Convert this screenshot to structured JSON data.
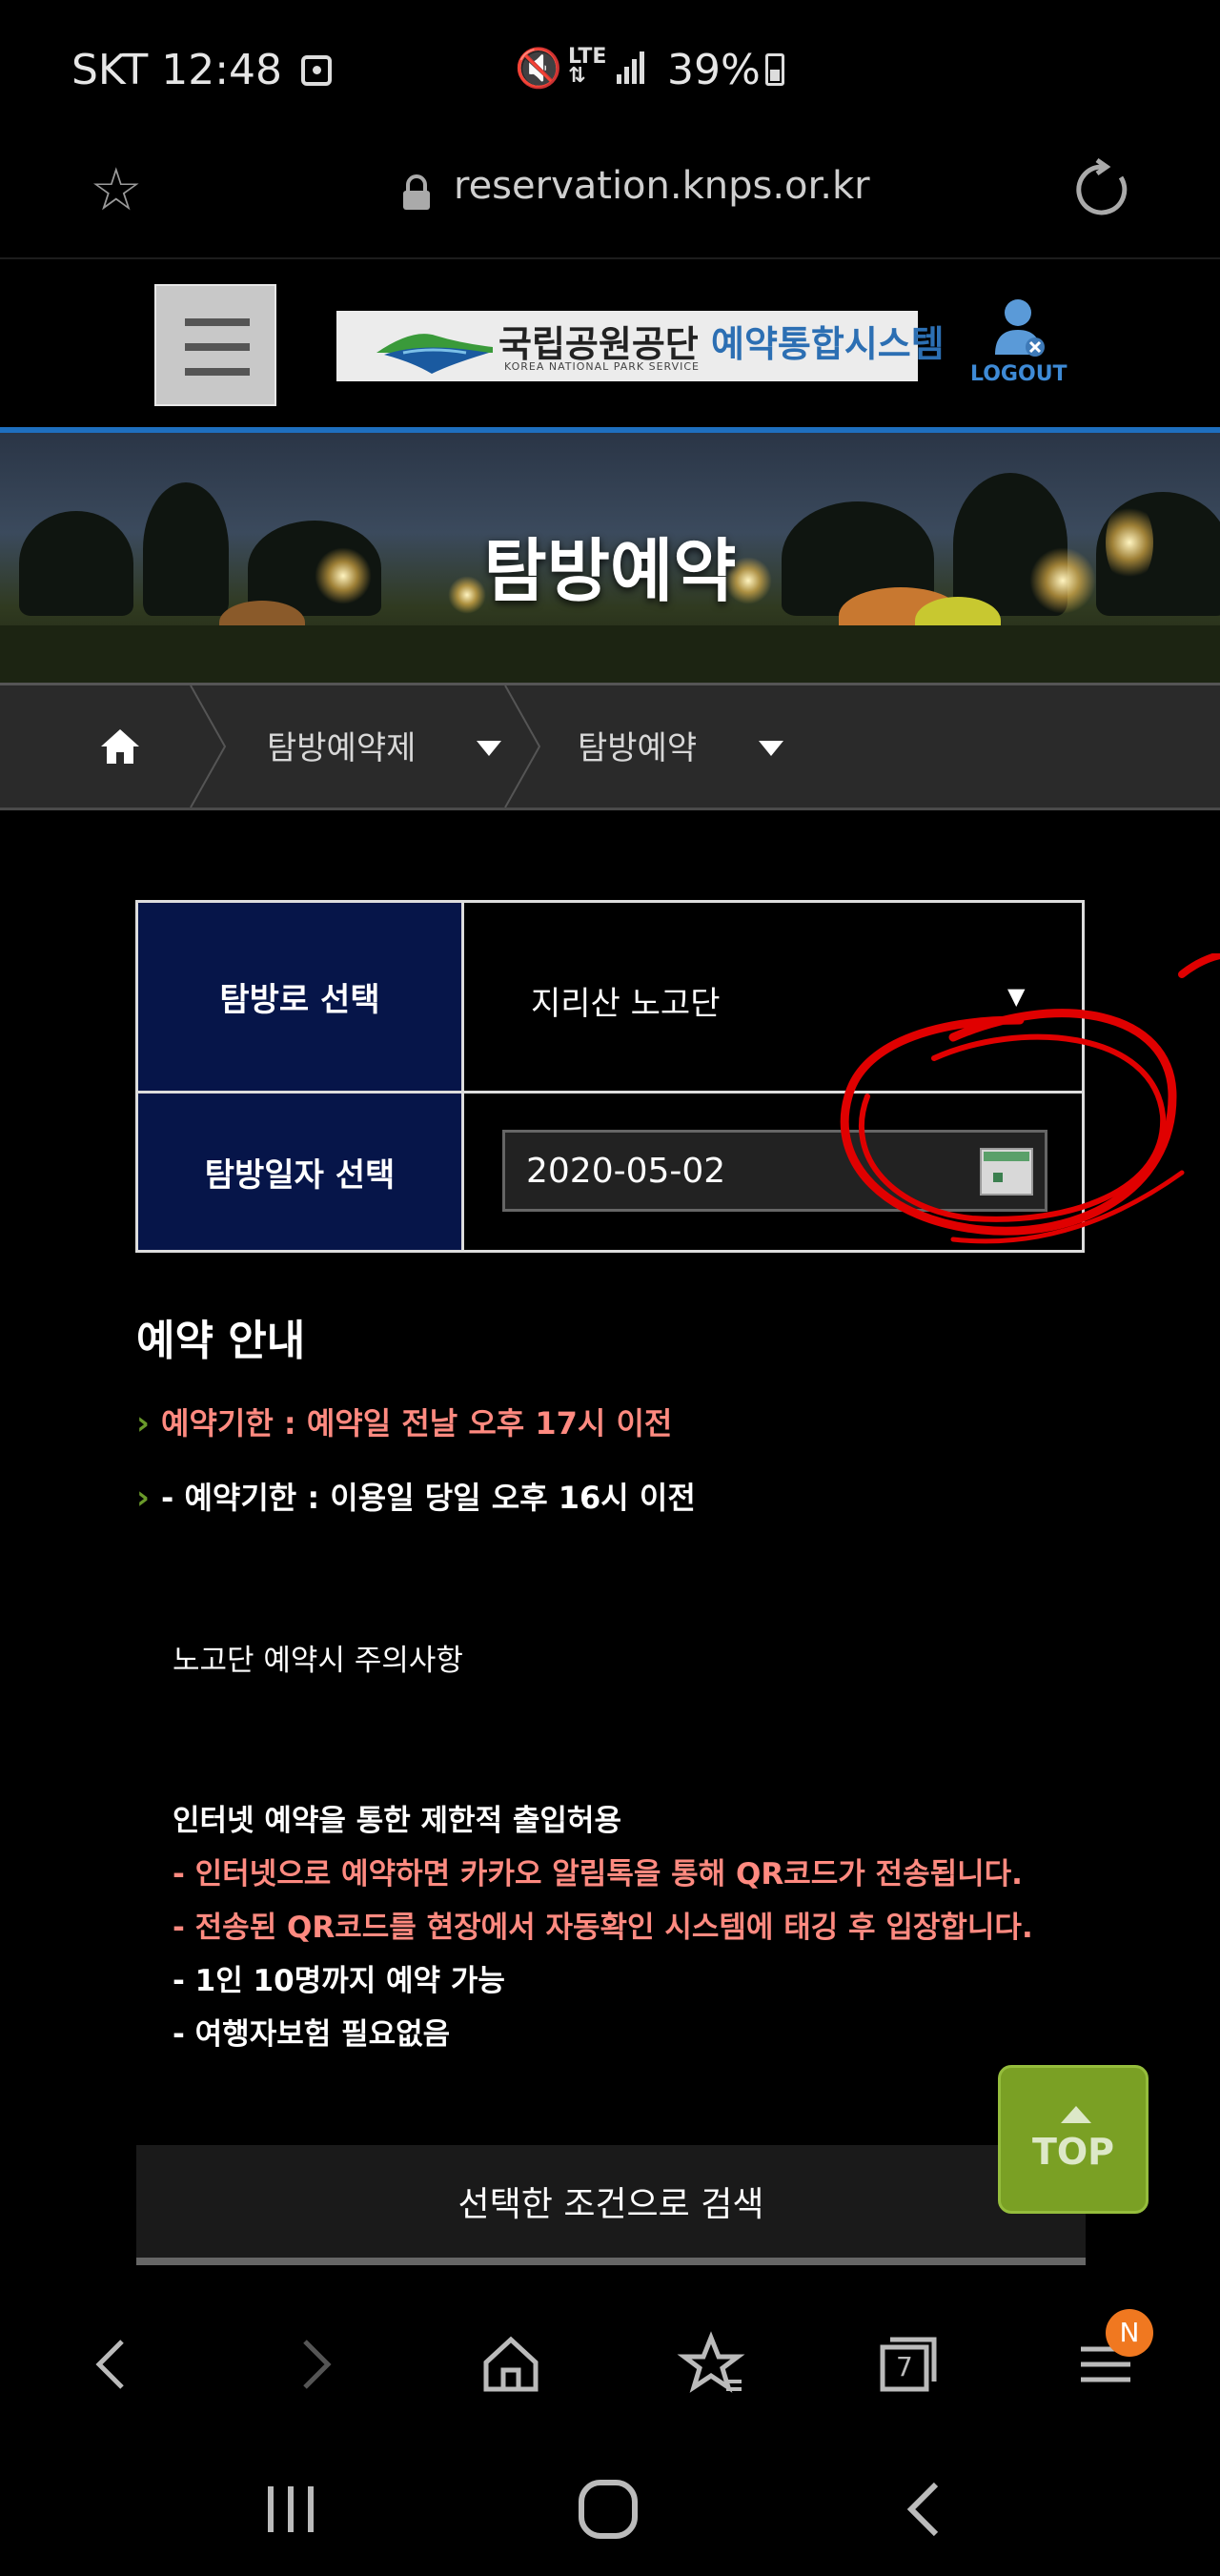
{
  "status_bar": {
    "carrier_time": "SKT 12:48",
    "network": "LTE",
    "battery": "39%"
  },
  "url_bar": {
    "url": "reservation.knps.or.kr"
  },
  "header": {
    "logo_name": "국립공원공단",
    "logo_system": "예약통합시스템",
    "logo_sub": "KOREA NATIONAL PARK SERVICE",
    "logout_label": "LOGOUT"
  },
  "banner": {
    "title": "탐방예약"
  },
  "breadcrumb": {
    "items": [
      "탐방예약제",
      "탐방예약"
    ]
  },
  "form": {
    "course_label": "탐방로 선택",
    "course_value": "지리산 노고단",
    "date_label": "탐방일자 선택",
    "date_value": "2020-05-02"
  },
  "info": {
    "title": "예약 안내",
    "items": [
      "예약기한 : 예약일 전날 오후 17시 이전",
      "- 예약기한 : 이용일 당일 오후 16시 이전"
    ],
    "notes": [
      "노고단 예약시 주의사항",
      "인터넷 예약을 통한 제한적 출입허용",
      "- 인터넷으로 예약하면 카카오 알림톡을 통해 QR코드가 전송됩니다.",
      "- 전송된 QR코드를 현장에서 자동확인 시스템에 태깅 후 입장합니다.",
      "- 1인 10명까지 예약 가능",
      "- 여행자보험 필요없음"
    ]
  },
  "search_button": "선택한 조건으로 검색",
  "top_button": "TOP",
  "browser_nav": {
    "tabs_count": "7",
    "menu_badge": "N"
  },
  "colors": {
    "form_header_bg": "#061549",
    "accent_red": "#ff8a80",
    "top_button_bg": "#7aa024",
    "header_blue_line": "#1e6fbf",
    "annotation_red": "#e00000"
  }
}
